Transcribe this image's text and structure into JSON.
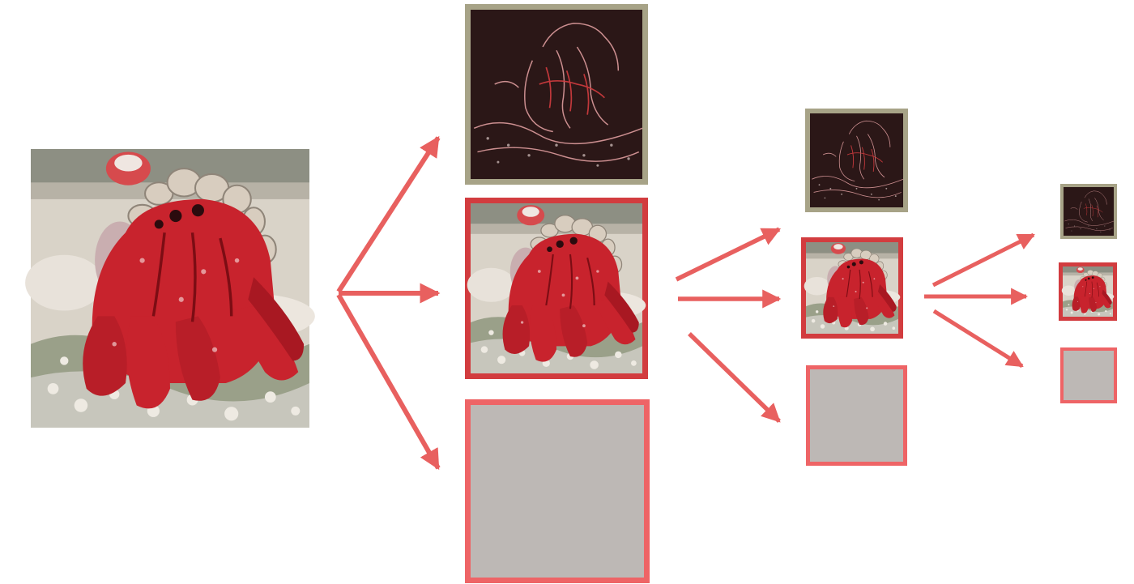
{
  "colors": {
    "arrow": "#e8605f",
    "detail_frame": "#a7a387",
    "detail_fill": "#2b1717",
    "approx_frame": "#d23c3f",
    "coarse_frame": "#ee6466",
    "coarse_fill": "#bdb8b5",
    "crab_red": "#c8232d",
    "crab_dark": "#7c0d14",
    "sand": "#d9d3c8",
    "sand_shadow": "#9aa089",
    "sky": "#8d8f83",
    "shell": "#d8cdbf",
    "edge_lines": "#e9a4a6"
  },
  "icons": {
    "source": "hermit-crab-photo-icon",
    "detail": "edge-detail-map-icon",
    "approx": "downscaled-crab-icon",
    "coarse": "flat-gray-map-icon"
  },
  "levels": [
    {
      "level": 1,
      "outputs": [
        "detail",
        "approx",
        "coarse"
      ]
    },
    {
      "level": 2,
      "outputs": [
        "detail",
        "approx",
        "coarse"
      ]
    },
    {
      "level": 3,
      "outputs": [
        "detail",
        "approx",
        "coarse"
      ]
    }
  ]
}
